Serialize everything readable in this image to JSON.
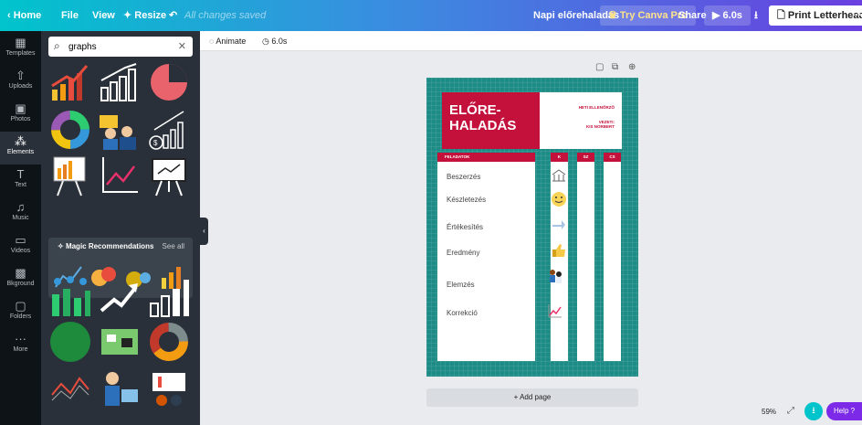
{
  "topbar": {
    "home": "Home",
    "file": "File",
    "view": "View",
    "resize": "Resize",
    "undo_icon": "undo-icon",
    "saved_status": "All changes saved",
    "doc_name": "Napi előrehaladás",
    "try_pro": "Try Canva Pro",
    "share": "Share",
    "play_time": "6.0s",
    "print_label": "Print Letterheads",
    "more": "···"
  },
  "rail": [
    {
      "label": "Templates",
      "icon": "▦"
    },
    {
      "label": "Uploads",
      "icon": "⇧"
    },
    {
      "label": "Photos",
      "icon": "▣"
    },
    {
      "label": "Elements",
      "icon": "⁂"
    },
    {
      "label": "Text",
      "icon": "T"
    },
    {
      "label": "Music",
      "icon": "♫"
    },
    {
      "label": "Videos",
      "icon": "▭"
    },
    {
      "label": "Bkground",
      "icon": "▩"
    },
    {
      "label": "Folders",
      "icon": "▢"
    },
    {
      "label": "More",
      "icon": "···"
    }
  ],
  "search": {
    "value": "graphs"
  },
  "magic": {
    "title": "Magic Recommendations",
    "see_all": "See all"
  },
  "toolbar": {
    "animate": "Animate",
    "duration": "6.0s"
  },
  "document": {
    "title_line1": "ELŐRE-",
    "title_line2": "HALADÁS",
    "subtitle": "HETI ELLENŐRZŐ",
    "leader_line1": "VEZETI:",
    "leader_line2": "KIS NORBERT",
    "columns": [
      "FELADATOK",
      "K",
      "SZ",
      "CS"
    ],
    "tasks": [
      "Beszerzés",
      "Készletezés",
      "Értékesítés",
      "Eredmény",
      "Elemzés",
      "Korrekció"
    ]
  },
  "colors": {
    "accent": "#c4113c",
    "teal": "#1e8c86",
    "brand": "#7d2ae8"
  },
  "footer": {
    "add_page": "+ Add page",
    "zoom": "59%",
    "help": "Help ?"
  }
}
